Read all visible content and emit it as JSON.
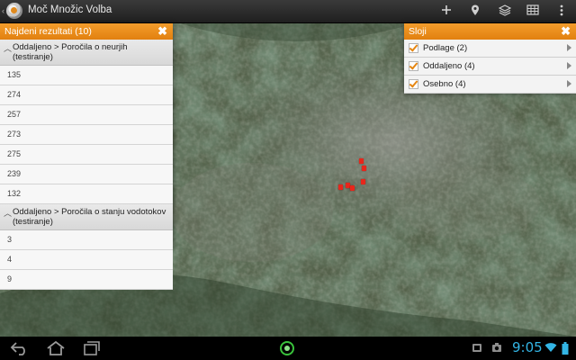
{
  "app": {
    "title": "Moč Množic Volba",
    "actions": [
      {
        "name": "add-icon"
      },
      {
        "name": "location-pin-icon"
      },
      {
        "name": "layers-icon"
      },
      {
        "name": "table-icon"
      },
      {
        "name": "overflow-menu-icon"
      }
    ]
  },
  "results_panel": {
    "title": "Najdeni rezultati (10)",
    "groups": [
      {
        "label": "Oddaljeno > Poročila o neurjih (testiranje)",
        "items": [
          "135",
          "274",
          "257",
          "273",
          "275",
          "239",
          "132"
        ]
      },
      {
        "label": "Oddaljeno > Poročila o stanju vodotokov (testiranje)",
        "items": [
          "3",
          "4",
          "9"
        ]
      }
    ]
  },
  "layers_panel": {
    "title": "Sloji",
    "items": [
      {
        "label": "Podlage (2)",
        "checked": true
      },
      {
        "label": "Oddaljeno (4)",
        "checked": true
      },
      {
        "label": "Osebno (4)",
        "checked": true
      }
    ]
  },
  "map": {
    "markers": 6,
    "marker_color": "#e8261b"
  },
  "system_bar": {
    "time": "9:05",
    "clock_color": "#33b5e5"
  },
  "colors": {
    "accent": "#e98a1a",
    "home_indicator": "#39c23b"
  }
}
